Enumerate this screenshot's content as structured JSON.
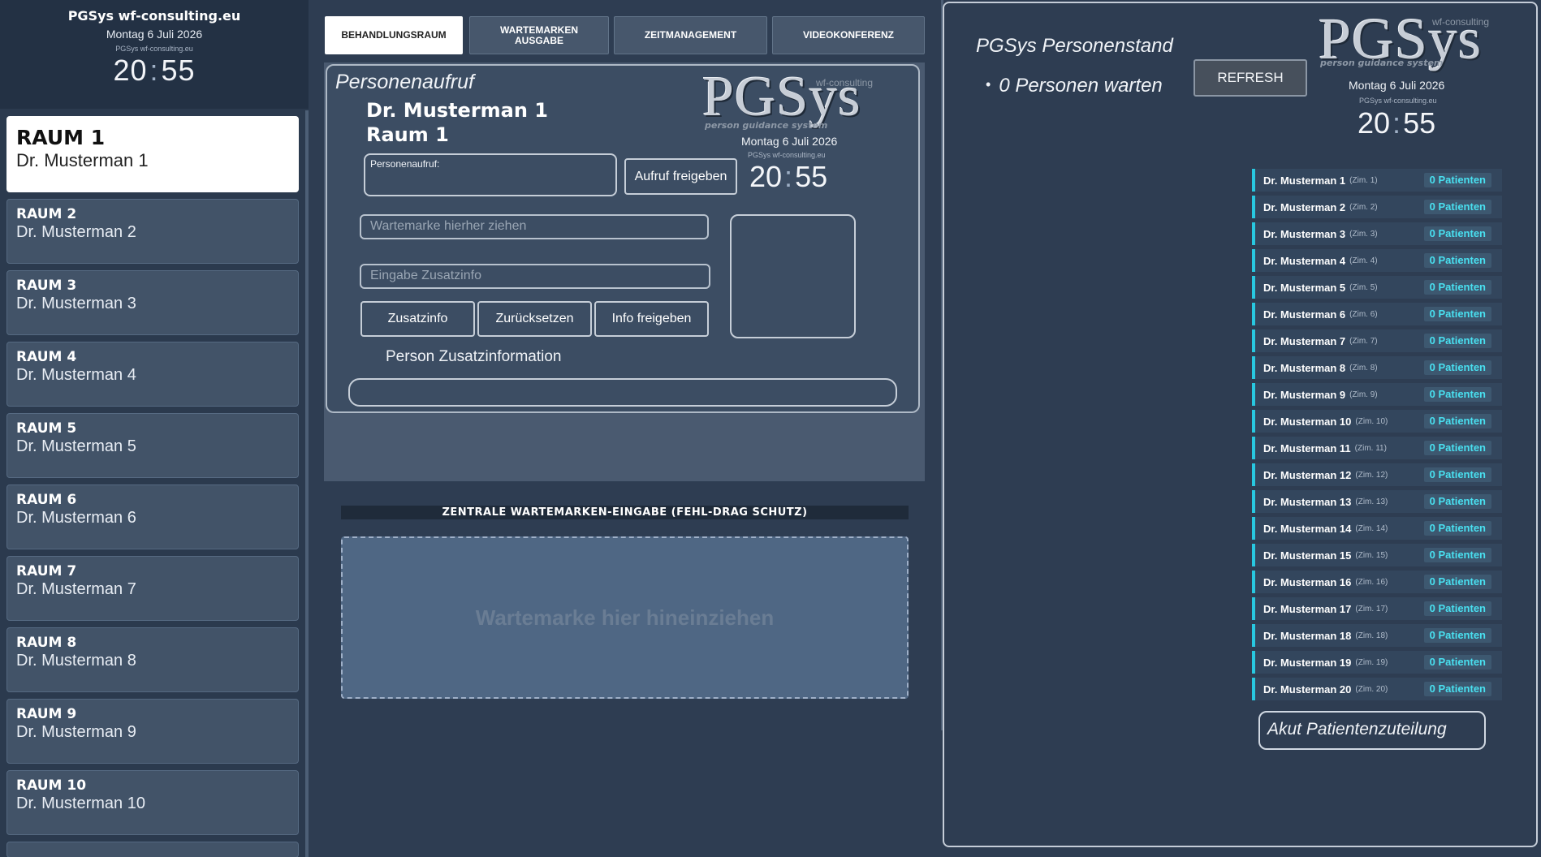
{
  "sidebar": {
    "org": "PGSys wf-consulting.eu",
    "date": "Montag 6 Juli 2026",
    "small_label": "PGSys wf-consulting.eu",
    "clock": {
      "hh": "20",
      "mm": "55"
    },
    "rooms": [
      {
        "room": "RAUM 1",
        "doctor": "Dr. Musterman 1"
      },
      {
        "room": "RAUM 2",
        "doctor": "Dr. Musterman 2"
      },
      {
        "room": "RAUM 3",
        "doctor": "Dr. Musterman 3"
      },
      {
        "room": "RAUM 4",
        "doctor": "Dr. Musterman 4"
      },
      {
        "room": "RAUM 5",
        "doctor": "Dr. Musterman 5"
      },
      {
        "room": "RAUM 6",
        "doctor": "Dr. Musterman 6"
      },
      {
        "room": "RAUM 7",
        "doctor": "Dr. Musterman 7"
      },
      {
        "room": "RAUM 8",
        "doctor": "Dr. Musterman 8"
      },
      {
        "room": "RAUM 9",
        "doctor": "Dr. Musterman 9"
      },
      {
        "room": "RAUM 10",
        "doctor": "Dr. Musterman 10"
      }
    ]
  },
  "tabs": [
    {
      "label": "BEHANDLUNGSRAUM"
    },
    {
      "line1": "WARTEMARKEN",
      "line2": "AUSGABE"
    },
    {
      "label": "ZEITMANAGEMENT"
    },
    {
      "label": "VIDEOKONFERENZ"
    }
  ],
  "call_panel": {
    "title": "Personenaufruf",
    "doctor": "Dr. Musterman 1",
    "room": "Raum 1",
    "logo": "PGSys",
    "logo_tag": "wf-consulting",
    "logo_sub": "person guidance system",
    "date": "Montag 6 Juli 2026",
    "small_label": "PGSys wf-consulting.eu",
    "clock": {
      "hh": "20",
      "mm": "55"
    },
    "call_field_label": "Personenaufruf:",
    "release_call_button": "Aufruf freigeben",
    "ticket_placeholder": "Wartemarke hierher ziehen",
    "extra_placeholder": "Eingabe Zusatzinfo",
    "btn_extra": "Zusatzinfo",
    "btn_reset": "Zurücksetzen",
    "btn_release_info": "Info freigeben",
    "extra_info_label": "Person Zusatzinformation"
  },
  "dropzone": {
    "title": "ZENTRALE WARTEMARKEN-EINGABE (FEHL-DRAG SCHUTZ)",
    "text": "Wartemarke hier hineinziehen"
  },
  "status": {
    "title": "PGSys Personenstand",
    "waiting": "0 Personen warten",
    "refresh": "REFRESH",
    "logo": "PGSys",
    "logo_tag": "wf-consulting",
    "logo_sub": "person guidance system",
    "date": "Montag 6 Juli 2026",
    "small_label": "PGSys wf-consulting.eu",
    "clock": {
      "hh": "20",
      "mm": "55"
    },
    "doctors": [
      {
        "name": "Dr. Musterman 1",
        "room": "(Zim. 1)",
        "count": "0 Patienten"
      },
      {
        "name": "Dr. Musterman 2",
        "room": "(Zim. 2)",
        "count": "0 Patienten"
      },
      {
        "name": "Dr. Musterman 3",
        "room": "(Zim. 3)",
        "count": "0 Patienten"
      },
      {
        "name": "Dr. Musterman 4",
        "room": "(Zim. 4)",
        "count": "0 Patienten"
      },
      {
        "name": "Dr. Musterman 5",
        "room": "(Zim. 5)",
        "count": "0 Patienten"
      },
      {
        "name": "Dr. Musterman 6",
        "room": "(Zim. 6)",
        "count": "0 Patienten"
      },
      {
        "name": "Dr. Musterman 7",
        "room": "(Zim. 7)",
        "count": "0 Patienten"
      },
      {
        "name": "Dr. Musterman 8",
        "room": "(Zim. 8)",
        "count": "0 Patienten"
      },
      {
        "name": "Dr. Musterman 9",
        "room": "(Zim. 9)",
        "count": "0 Patienten"
      },
      {
        "name": "Dr. Musterman 10",
        "room": "(Zim. 10)",
        "count": "0 Patienten"
      },
      {
        "name": "Dr. Musterman 11",
        "room": "(Zim. 11)",
        "count": "0 Patienten"
      },
      {
        "name": "Dr. Musterman 12",
        "room": "(Zim. 12)",
        "count": "0 Patienten"
      },
      {
        "name": "Dr. Musterman 13",
        "room": "(Zim. 13)",
        "count": "0 Patienten"
      },
      {
        "name": "Dr. Musterman 14",
        "room": "(Zim. 14)",
        "count": "0 Patienten"
      },
      {
        "name": "Dr. Musterman 15",
        "room": "(Zim. 15)",
        "count": "0 Patienten"
      },
      {
        "name": "Dr. Musterman 16",
        "room": "(Zim. 16)",
        "count": "0 Patienten"
      },
      {
        "name": "Dr. Musterman 17",
        "room": "(Zim. 17)",
        "count": "0 Patienten"
      },
      {
        "name": "Dr. Musterman 18",
        "room": "(Zim. 18)",
        "count": "0 Patienten"
      },
      {
        "name": "Dr. Musterman 19",
        "room": "(Zim. 19)",
        "count": "0 Patienten"
      },
      {
        "name": "Dr. Musterman 20",
        "room": "(Zim. 20)",
        "count": "0 Patienten"
      }
    ],
    "akut": "Akut Patientenzuteilung"
  },
  "colors": {
    "background": "#2e3d52",
    "accent_cyan": "#49e0f0",
    "active_tab": "#ffffff"
  }
}
